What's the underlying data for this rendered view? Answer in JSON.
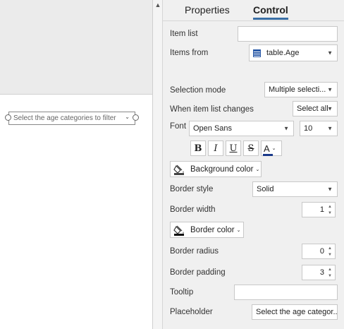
{
  "canvas": {
    "slicer_placeholder": "Select the age categories to filter"
  },
  "tabs": [
    {
      "label": "Properties",
      "active": false
    },
    {
      "label": "Control",
      "active": true
    }
  ],
  "properties": {
    "item_list": {
      "label": "Item list",
      "value": ""
    },
    "items_from": {
      "label": "Items from",
      "value": "table.Age",
      "icon": "table-icon"
    },
    "selection_mode": {
      "label": "Selection mode",
      "value": "Multiple selecti..."
    },
    "when_item_list_changes": {
      "label": "When item list changes",
      "value": "Select all"
    },
    "font": {
      "label": "Font",
      "family": "Open Sans",
      "size": "10"
    },
    "format_buttons": {
      "bold": "B",
      "italic": "I",
      "underline": "U",
      "strike": "S",
      "color": "A"
    },
    "background_color": {
      "label": "Background color"
    },
    "border_style": {
      "label": "Border style",
      "value": "Solid"
    },
    "border_width": {
      "label": "Border width",
      "value": "1"
    },
    "border_color": {
      "label": "Border color"
    },
    "border_radius": {
      "label": "Border radius",
      "value": "0"
    },
    "border_padding": {
      "label": "Border padding",
      "value": "3"
    },
    "tooltip": {
      "label": "Tooltip",
      "value": ""
    },
    "placeholder": {
      "label": "Placeholder",
      "value": "Select the age categor..."
    }
  },
  "colors": {
    "accent": "#3a6ea5",
    "panel_bg": "#f0f0f0",
    "text_color_swatch": "#1a3a8a"
  }
}
